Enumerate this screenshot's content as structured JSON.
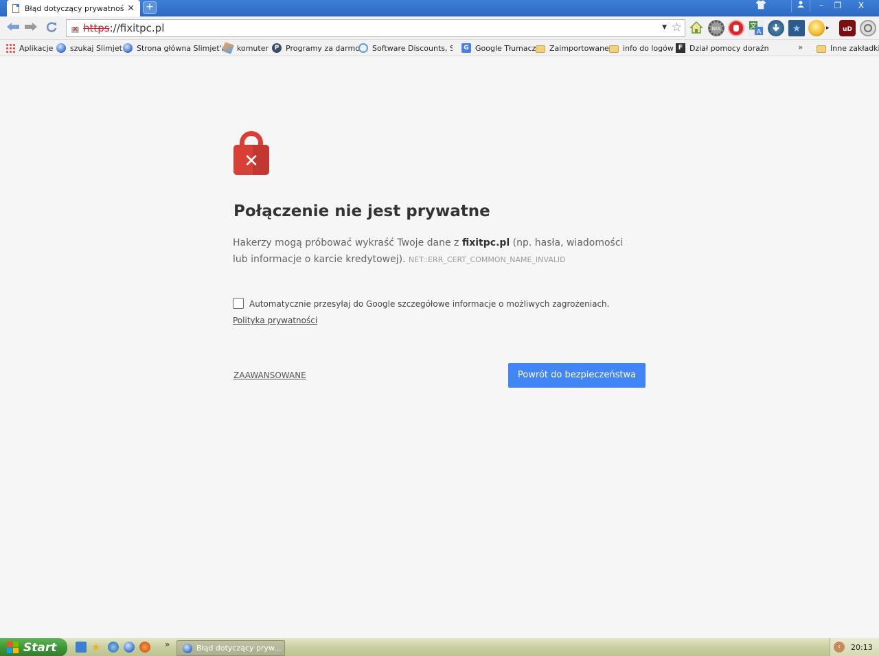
{
  "browser": {
    "tab_title": "Błąd dotyczący prywatności",
    "tab_close": "✕",
    "new_tab": "+",
    "window_controls": {
      "minimize": "–",
      "maximize": "❐",
      "close": "X"
    },
    "url_scheme": "https",
    "url_rest": "://fixitpc.pl"
  },
  "bookmarks": [
    {
      "label": "Aplikacje",
      "icon": "apps-grid-icon"
    },
    {
      "label": "szukaj Slimjet",
      "icon": "globe-icon"
    },
    {
      "label": "Strona główna Slimjet'a",
      "icon": "globe-icon"
    },
    {
      "label": "komuter",
      "icon": "wizard-icon"
    },
    {
      "label": "Programy za darmo",
      "icon": "p-icon"
    },
    {
      "label": "Software Discounts, Sof",
      "icon": "software-icon"
    },
    {
      "label": "Google Tłumacz",
      "icon": "google-translate-icon"
    },
    {
      "label": "Zaimportowane",
      "icon": "folder-icon"
    },
    {
      "label": "info do logów",
      "icon": "folder-icon"
    },
    {
      "label": "Dział pomocy doraźnej ·",
      "icon": "f-icon"
    },
    {
      "label": "Inne zakładki",
      "icon": "folder-icon"
    }
  ],
  "bookmarks_more": "»",
  "interstitial": {
    "heading": "Połączenie nie jest prywatne",
    "para_before": "Hakerzy mogą próbować wykraść Twoje dane z ",
    "para_domain": "fixitpc.pl",
    "para_after": " (np. hasła, wiadomości lub informacje o karcie kredytowej). ",
    "error_code": "NET::ERR_CERT_COMMON_NAME_INVALID",
    "checkbox_text": "Automatycznie przesyłaj do Google szczegółowe informacje o możliwych zagrożeniach. ",
    "policy_link": "Polityka prywatności",
    "advanced_link": "ZAAWANSOWANE",
    "back_button": "Powrót do bezpieczeństwa",
    "checkbox_checked": false
  },
  "colors": {
    "error_red": "#d73f37",
    "primary_blue": "#4285f4",
    "page_bg": "#f6f6f6"
  },
  "taskbar": {
    "start_label": "Start",
    "quick_launch_more": "»",
    "task_label": "Błąd dotyczący pryw...",
    "clock": "20:13"
  }
}
